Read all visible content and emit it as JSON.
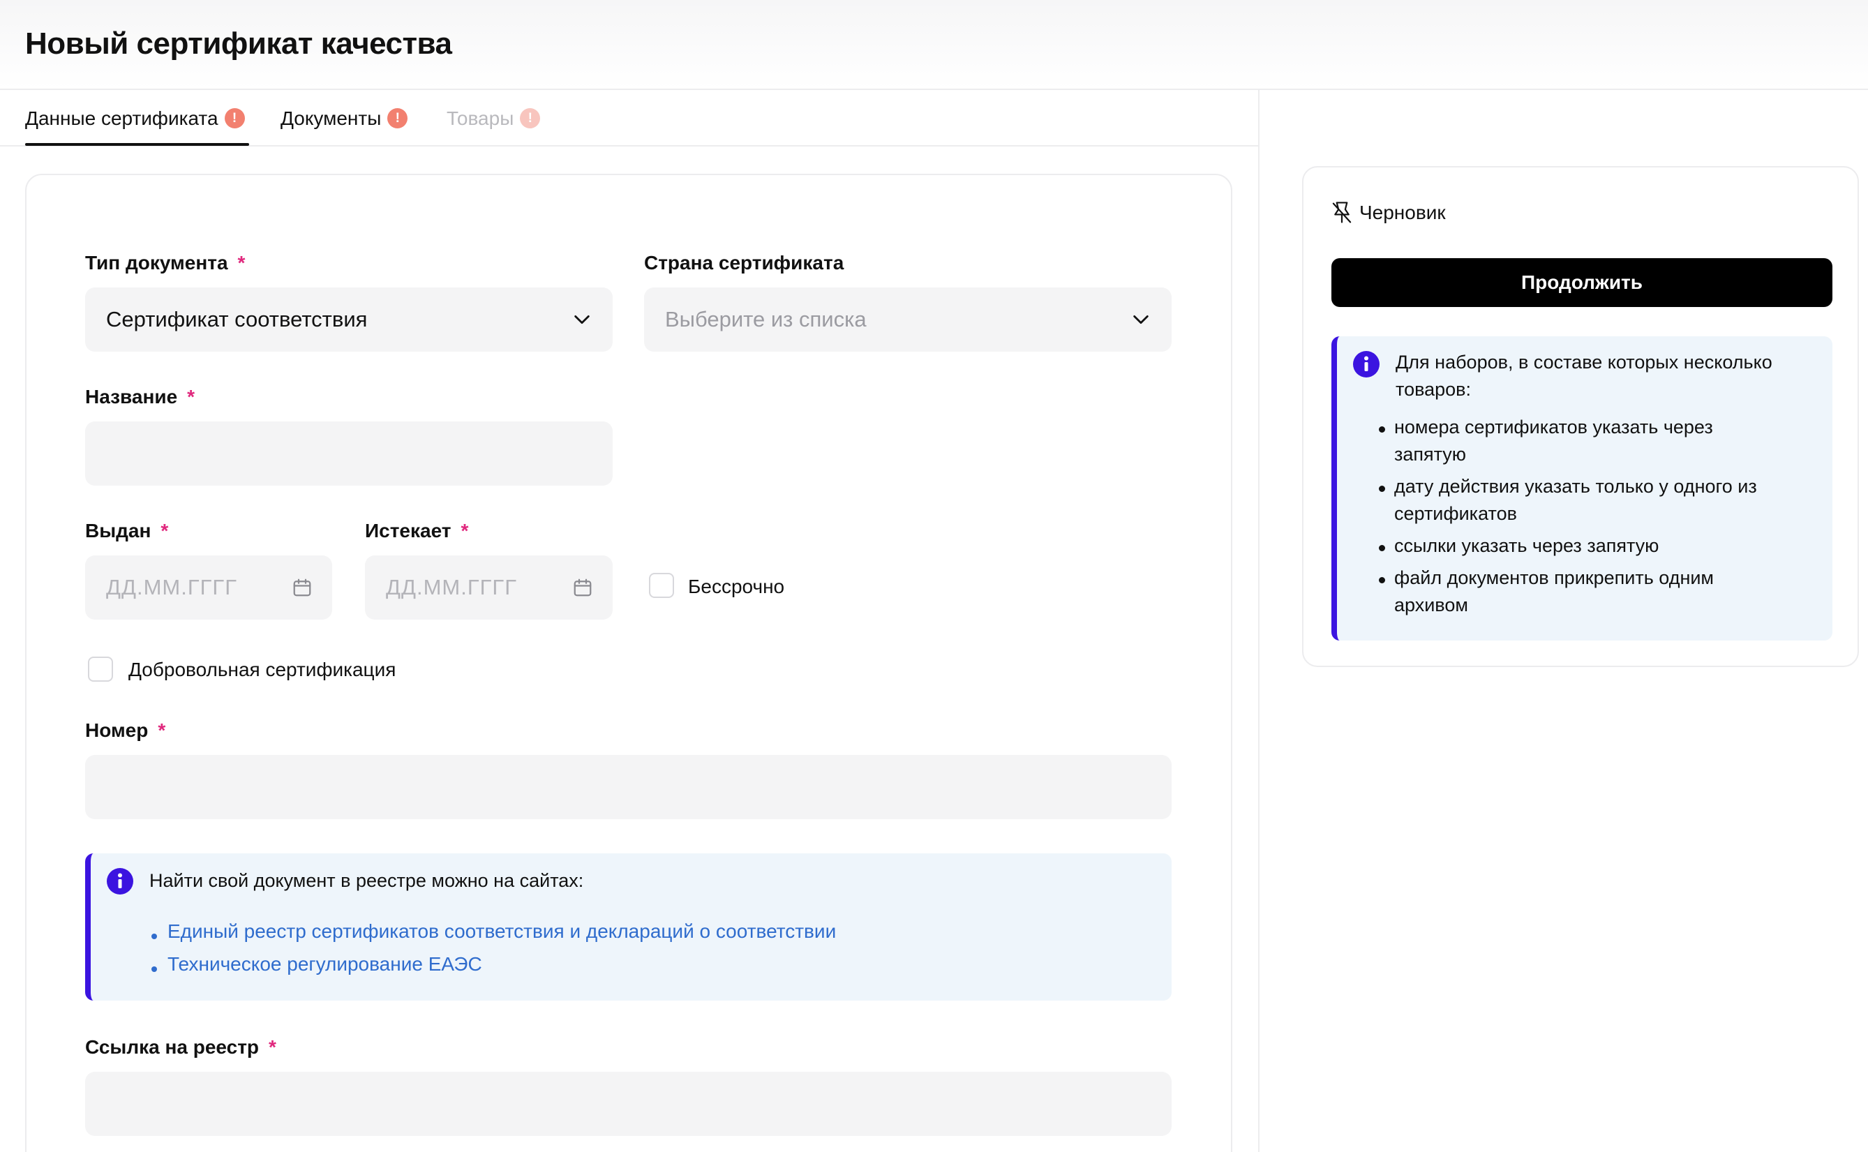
{
  "page": {
    "title": "Новый сертификат качества"
  },
  "tabs": [
    {
      "label": "Данные сертификата",
      "badge": "!",
      "active": true
    },
    {
      "label": "Документы",
      "badge": "!",
      "active": false
    },
    {
      "label": "Товары",
      "badge": "!",
      "active": false,
      "disabled": true
    }
  ],
  "form": {
    "doc_type": {
      "label": "Тип документа",
      "required": "*",
      "value": "Сертификат соответствия"
    },
    "country": {
      "label": "Страна сертификата",
      "placeholder": "Выберите из списка"
    },
    "name": {
      "label": "Название",
      "required": "*",
      "value": ""
    },
    "issued": {
      "label": "Выдан",
      "required": "*",
      "placeholder": "ДД.ММ.ГГГГ"
    },
    "expires": {
      "label": "Истекает",
      "required": "*",
      "placeholder": "ДД.ММ.ГГГГ"
    },
    "indefinite": {
      "label": "Бессрочно",
      "checked": false
    },
    "voluntary": {
      "label": "Добровольная сертификация",
      "checked": false
    },
    "number": {
      "label": "Номер",
      "required": "*",
      "value": ""
    },
    "registry_info": {
      "text": "Найти свой документ в реестре можно на сайтах:",
      "links": [
        "Единый реестр сертификатов соответствия и деклараций о соответствии",
        "Техническое регулирование ЕАЭС"
      ]
    },
    "registry_link": {
      "label": "Ссылка на реестр",
      "required": "*",
      "value": ""
    }
  },
  "sidebar": {
    "status": "Черновик",
    "continue_label": "Продолжить",
    "info": {
      "text_line1": "Для наборов, в составе которых несколько",
      "text_line2": "товаров:",
      "items": [
        {
          "line1": "номера сертификатов указать через",
          "line2": "запятую"
        },
        {
          "line1": "дату действия указать только у одного из",
          "line2": "сертификатов"
        },
        {
          "line1": "ссылки указать через запятую",
          "line2": ""
        },
        {
          "line1": "файл документов прикрепить одним",
          "line2": "архивом"
        }
      ]
    }
  },
  "colors": {
    "accent": "#3b14e0",
    "required": "#e0287d",
    "badge": "#f2806f",
    "link": "#2f6ccd",
    "info_bg": "#eef5fb",
    "field_bg": "#f4f4f5",
    "button_bg": "#000000"
  },
  "icons": [
    "chevron-down-icon",
    "calendar-icon",
    "info-icon",
    "draft-icon"
  ]
}
